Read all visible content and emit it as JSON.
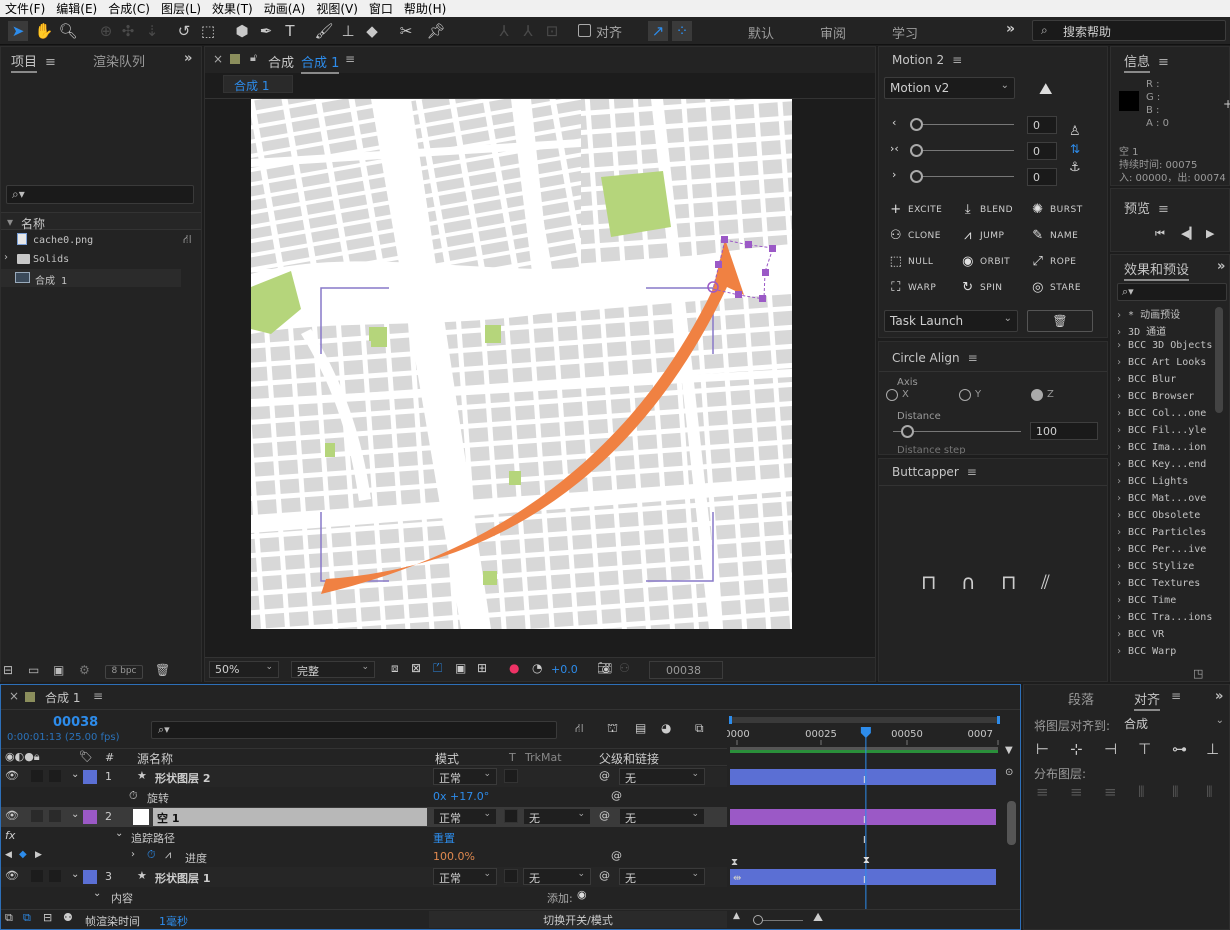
{
  "menu": [
    "文件(F)",
    "编辑(E)",
    "合成(C)",
    "图层(L)",
    "效果(T)",
    "动画(A)",
    "视图(V)",
    "窗口",
    "帮助(H)"
  ],
  "toolbar": {
    "snap_label": "对齐",
    "workspaces": [
      "默认",
      "审阅",
      "学习"
    ],
    "search_placeholder": "搜索帮助"
  },
  "project_panel": {
    "tabs": [
      "项目",
      "渲染队列"
    ],
    "column_name": "名称",
    "items": [
      {
        "name": "cache0.png",
        "type": "image"
      },
      {
        "name": "Solids",
        "type": "folder"
      },
      {
        "name": "合成 1",
        "type": "comp"
      }
    ],
    "bpc": "8 bpc"
  },
  "comp_panel": {
    "tab_prefix": "合成",
    "tab_name": "合成 1",
    "subtab": "合成 1",
    "zoom": "50%",
    "resolution": "完整",
    "exposure": "+0.0",
    "timecode": "00038"
  },
  "motion_panel": {
    "title": "Motion 2",
    "version": "Motion v2",
    "sliders": [
      {
        "icon": "ease-in",
        "value": "0"
      },
      {
        "icon": "ease-both",
        "value": "0"
      },
      {
        "icon": "ease-out",
        "value": "0"
      }
    ],
    "buttons": [
      "EXCITE",
      "BLEND",
      "BURST",
      "CLONE",
      "JUMP",
      "NAME",
      "NULL",
      "ORBIT",
      "ROPE",
      "WARP",
      "SPIN",
      "STARE"
    ],
    "task": "Task Launch"
  },
  "circle_align": {
    "title": "Circle Align",
    "axis_label": "Axis",
    "axes": [
      "X",
      "Y",
      "Z"
    ],
    "selected_axis": "Z",
    "distance_label": "Distance",
    "distance_value": "100",
    "distance_step_label": "Distance step"
  },
  "buttcapper": {
    "title": "Buttcapper"
  },
  "info_panel": {
    "title": "信息",
    "r": "R :",
    "g": "G :",
    "b": "B :",
    "a": "A : 0",
    "layer_name": "空 1",
    "duration": "持续时间: 00075",
    "in_out": "入: 00000，出: 00074"
  },
  "preview_panel": {
    "title": "预览"
  },
  "effects_panel": {
    "title": "效果和预设",
    "items": [
      "* 动画预设",
      "3D 通道",
      "BCC 3D Objects",
      "BCC Art Looks",
      "BCC Blur",
      "BCC Browser",
      "BCC Col...one",
      "BCC Fil...yle",
      "BCC Ima...ion",
      "BCC Key...end",
      "BCC Lights",
      "BCC Mat...ove",
      "BCC Obsolete",
      "BCC Particles",
      "BCC Per...ive",
      "BCC Stylize",
      "BCC Textures",
      "BCC Time",
      "BCC Tra...ions",
      "BCC VR",
      "BCC Warp"
    ]
  },
  "timeline": {
    "tab": "合成 1",
    "timecode": "00038",
    "timecode_sub": "0:00:01:13 (25.00 fps)",
    "headers": {
      "num": "#",
      "source": "源名称",
      "mode": "模式",
      "t": "T",
      "trkmat": "TrkMat",
      "parent": "父级和链接"
    },
    "ruler": [
      "0000",
      "00025",
      "00050",
      "0007"
    ],
    "playhead_fraction": 0.507,
    "layers": [
      {
        "index": "1",
        "name": "形状图层 2",
        "mode": "正常",
        "trkmat": "",
        "parent": "无",
        "color": "#5b6fd4"
      },
      {
        "index": "2",
        "name": "空 1",
        "mode": "正常",
        "trkmat": "无",
        "parent": "无",
        "color": "#9b59c6"
      },
      {
        "index": "3",
        "name": "形状图层 1",
        "mode": "正常",
        "trkmat": "无",
        "parent": "无",
        "color": "#5b6fd4"
      }
    ],
    "rotation_label": "旋转",
    "rotation_value": "0x +17.0°",
    "effect_label": "追踪路径",
    "reset_label": "重置",
    "progress_label": "进度",
    "progress_value": "100.0%",
    "contents_label": "内容",
    "add_label": "添加:",
    "footer_label": "帧渲染时间",
    "footer_value": "1毫秒",
    "toggle_label": "切换开关/模式"
  },
  "align_panel": {
    "tabs": [
      "段落",
      "对齐"
    ],
    "align_to_label": "将图层对齐到:",
    "align_to_value": "合成",
    "distribute_label": "分布图层:"
  }
}
